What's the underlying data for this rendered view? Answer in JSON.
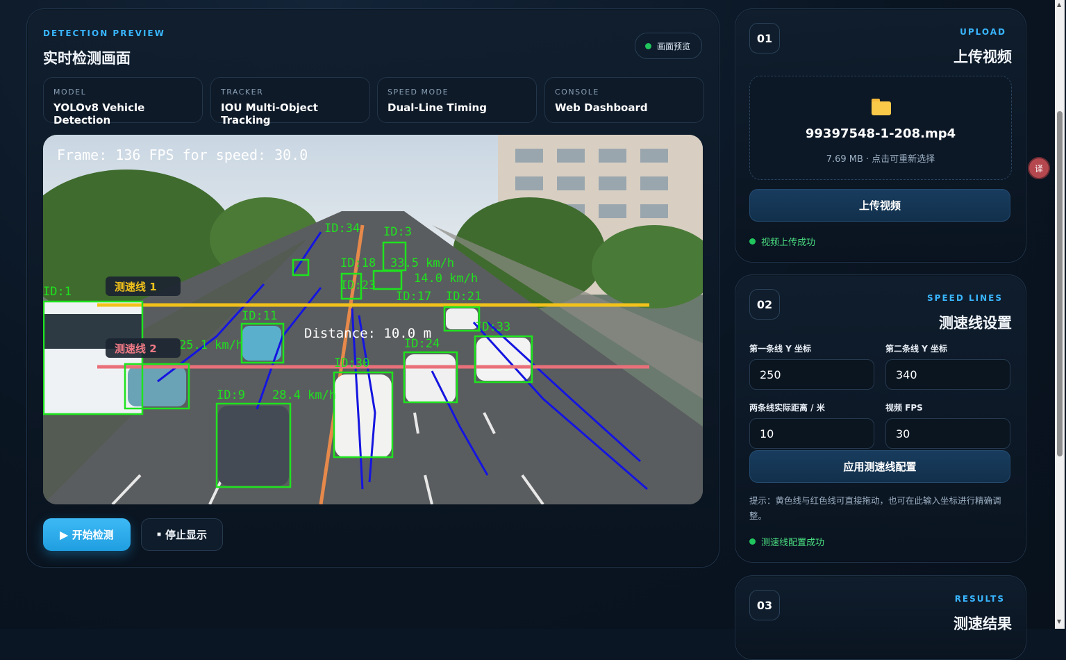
{
  "detection": {
    "eyebrow": "DETECTION PREVIEW",
    "title": "实时检测画面",
    "badge": "画面预览",
    "info_cards": [
      {
        "key": "MODEL",
        "value": "YOLOv8 Vehicle Detection"
      },
      {
        "key": "TRACKER",
        "value": "IOU Multi-Object Tracking"
      },
      {
        "key": "SPEED MODE",
        "value": "Dual-Line Timing"
      },
      {
        "key": "CONSOLE",
        "value": "Web Dashboard"
      }
    ],
    "overlay": {
      "frame_text": "Frame: 136  FPS for speed: 30.0",
      "line1_label": "测速线 1",
      "line2_label": "测速线 2",
      "distance_text": "Distance: 10.0 m",
      "boxes": [
        {
          "id": "ID:1",
          "speed": ""
        },
        {
          "id": "ID:9",
          "speed": "28.4 km/h"
        },
        {
          "id": "ID:11",
          "speed": "25.1 km/h"
        },
        {
          "id": "ID:17",
          "speed": "14.0 km/h"
        },
        {
          "id": "ID:18",
          "speed": "33.5 km/h"
        },
        {
          "id": "ID:21",
          "speed": ""
        },
        {
          "id": "ID:23",
          "speed": ""
        },
        {
          "id": "ID:24",
          "speed": ""
        },
        {
          "id": "ID:30",
          "speed": ""
        },
        {
          "id": "ID:33",
          "speed": ""
        },
        {
          "id": "ID:34",
          "speed": ""
        },
        {
          "id": "ID:3",
          "speed": ""
        }
      ]
    },
    "start_button": "开始检测",
    "stop_button": "停止显示"
  },
  "upload": {
    "number": "01",
    "eyebrow": "UPLOAD",
    "title": "上传视频",
    "file_name": "99397548-1-208.mp4",
    "file_meta": "7.69 MB · 点击可重新选择",
    "button": "上传视频",
    "status": "视频上传成功"
  },
  "speed_lines": {
    "number": "02",
    "eyebrow": "SPEED LINES",
    "title": "测速线设置",
    "line1_label": "第一条线 Y 坐标",
    "line1_value": "250",
    "line2_label": "第二条线 Y 坐标",
    "line2_value": "340",
    "distance_label": "两条线实际距离 / 米",
    "distance_value": "10",
    "fps_label": "视频 FPS",
    "fps_value": "30",
    "button": "应用测速线配置",
    "hint": "提示：黄色线与红色线可直接拖动，也可在此输入坐标进行精确调整。",
    "status": "测速线配置成功"
  },
  "results": {
    "number": "03",
    "eyebrow": "RESULTS",
    "title": "测速结果"
  },
  "colors": {
    "accent": "#39b6ff",
    "success": "#4ade80",
    "yellow_line": "#f2c21b",
    "red_line": "#e9707a",
    "box_green": "#1ee31e",
    "track_blue": "#1515e0"
  },
  "icons": {
    "folder": "folder-icon",
    "play": "play-icon",
    "stop": "stop-icon",
    "status_dot": "status-dot-icon",
    "translate": "translate-icon"
  }
}
